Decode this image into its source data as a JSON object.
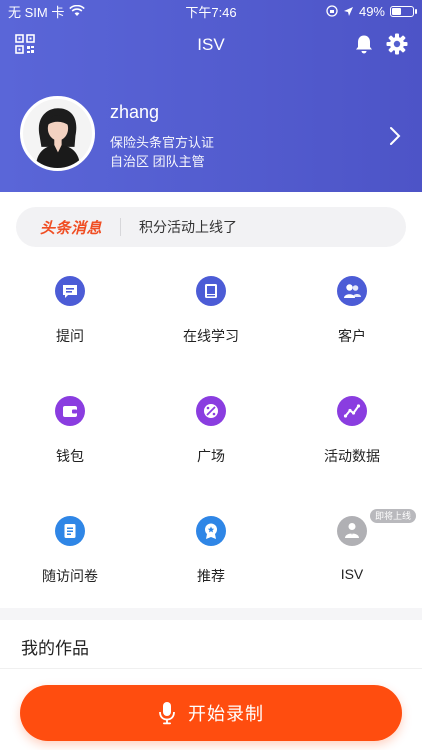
{
  "status": {
    "carrier": "无 SIM 卡",
    "time": "下午7:46",
    "battery": "49%",
    "battery_level": 0.49
  },
  "nav": {
    "title": "ISV"
  },
  "profile": {
    "name": "zhang",
    "certification": "保险头条官方认证",
    "role": "自治区  团队主管"
  },
  "news": {
    "tag": "头条消息",
    "text": "积分活动上线了"
  },
  "grid": [
    {
      "label": "提问",
      "icon": "question-icon",
      "color": "#4c5cd6"
    },
    {
      "label": "在线学习",
      "icon": "book-icon",
      "color": "#4c5cd6"
    },
    {
      "label": "客户",
      "icon": "customers-icon",
      "color": "#4c5cd6"
    },
    {
      "label": "钱包",
      "icon": "wallet-icon",
      "color": "#8a3de0"
    },
    {
      "label": "广场",
      "icon": "plaza-icon",
      "color": "#8a3de0"
    },
    {
      "label": "活动数据",
      "icon": "chart-icon",
      "color": "#8a3de0"
    },
    {
      "label": "随访问卷",
      "icon": "survey-icon",
      "color": "#2f86e6"
    },
    {
      "label": "推荐",
      "icon": "recommend-icon",
      "color": "#2f86e6"
    },
    {
      "label": "ISV",
      "icon": "isv-icon",
      "color": "#b0b0b4"
    }
  ],
  "badge": "即将上线",
  "works": {
    "title": "我的作品"
  },
  "record": {
    "label": "开始录制"
  },
  "colors": {
    "header": "#5a66d8",
    "accent": "#ff4d0f",
    "news_tag": "#f04e23"
  }
}
